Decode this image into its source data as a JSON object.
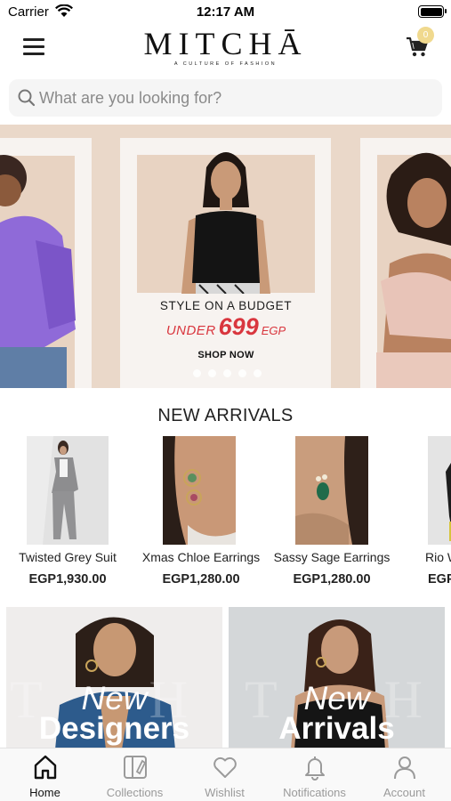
{
  "status_bar": {
    "carrier": "Carrier",
    "time": "12:17 AM"
  },
  "header": {
    "brand": "MITCHĀ",
    "tagline": "A CULTURE OF FASHION",
    "cart_count": "0"
  },
  "search": {
    "placeholder": "What are you looking for?"
  },
  "hero": {
    "title": "STYLE ON A BUDGET",
    "under_text": "UNDER",
    "price": "699",
    "currency": "EGP",
    "cta": "SHOP NOW",
    "slide_count": 5
  },
  "new_arrivals": {
    "title": "NEW ARRIVALS",
    "products": [
      {
        "name": "Twisted Grey Suit",
        "price": "EGP1,930.00"
      },
      {
        "name": "Xmas Chloe Earrings",
        "price": "EGP1,280.00"
      },
      {
        "name": "Sassy Sage Earrings",
        "price": "EGP1,280.00"
      },
      {
        "name": "Rio W",
        "price": "EGP"
      }
    ]
  },
  "promos": [
    {
      "line1": "New",
      "line2": "Designers"
    },
    {
      "line1": "New",
      "line2": "Arrivals"
    }
  ],
  "tabs": [
    {
      "label": "Home",
      "icon": "home-icon",
      "active": true
    },
    {
      "label": "Collections",
      "icon": "collections-icon",
      "active": false
    },
    {
      "label": "Wishlist",
      "icon": "heart-icon",
      "active": false
    },
    {
      "label": "Notifications",
      "icon": "bell-icon",
      "active": false
    },
    {
      "label": "Account",
      "icon": "user-icon",
      "active": false
    }
  ],
  "colors": {
    "accent_red": "#d9363e",
    "badge_gold": "#f0d98e",
    "active_tab": "#111111",
    "inactive_tab": "#9a9a9a"
  }
}
